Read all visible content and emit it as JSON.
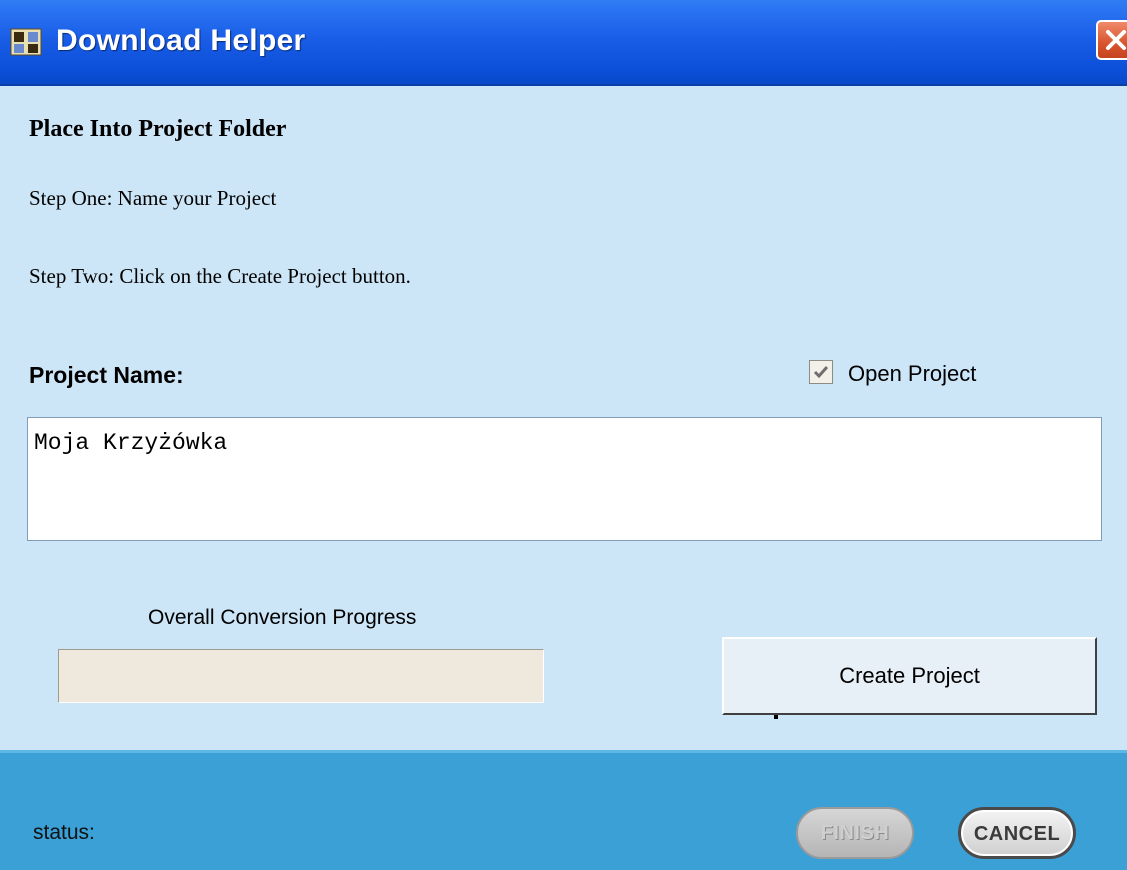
{
  "window": {
    "title": "Download Helper",
    "app_icon": "app-icon",
    "close_icon": "close-icon"
  },
  "content": {
    "heading": "Place Into Project Folder",
    "step_one": "Step One:  Name your Project",
    "step_two": "Step Two:  Click on the Create Project button.",
    "project_name_label": "Project Name:",
    "open_project_label": "Open Project",
    "open_project_checked": true,
    "project_name_value": "Moja Krzyżówka",
    "progress_label": "Overall Conversion Progress",
    "progress_value": 0,
    "create_button_label": "Create Project"
  },
  "footer": {
    "status_label": "status:",
    "finish_label": "FINISH",
    "finish_enabled": false,
    "cancel_label": "CANCEL"
  },
  "colors": {
    "titlebar": "#0b4fd8",
    "content_bg": "#cde6f7",
    "footer_bg": "#3aa0d6"
  }
}
